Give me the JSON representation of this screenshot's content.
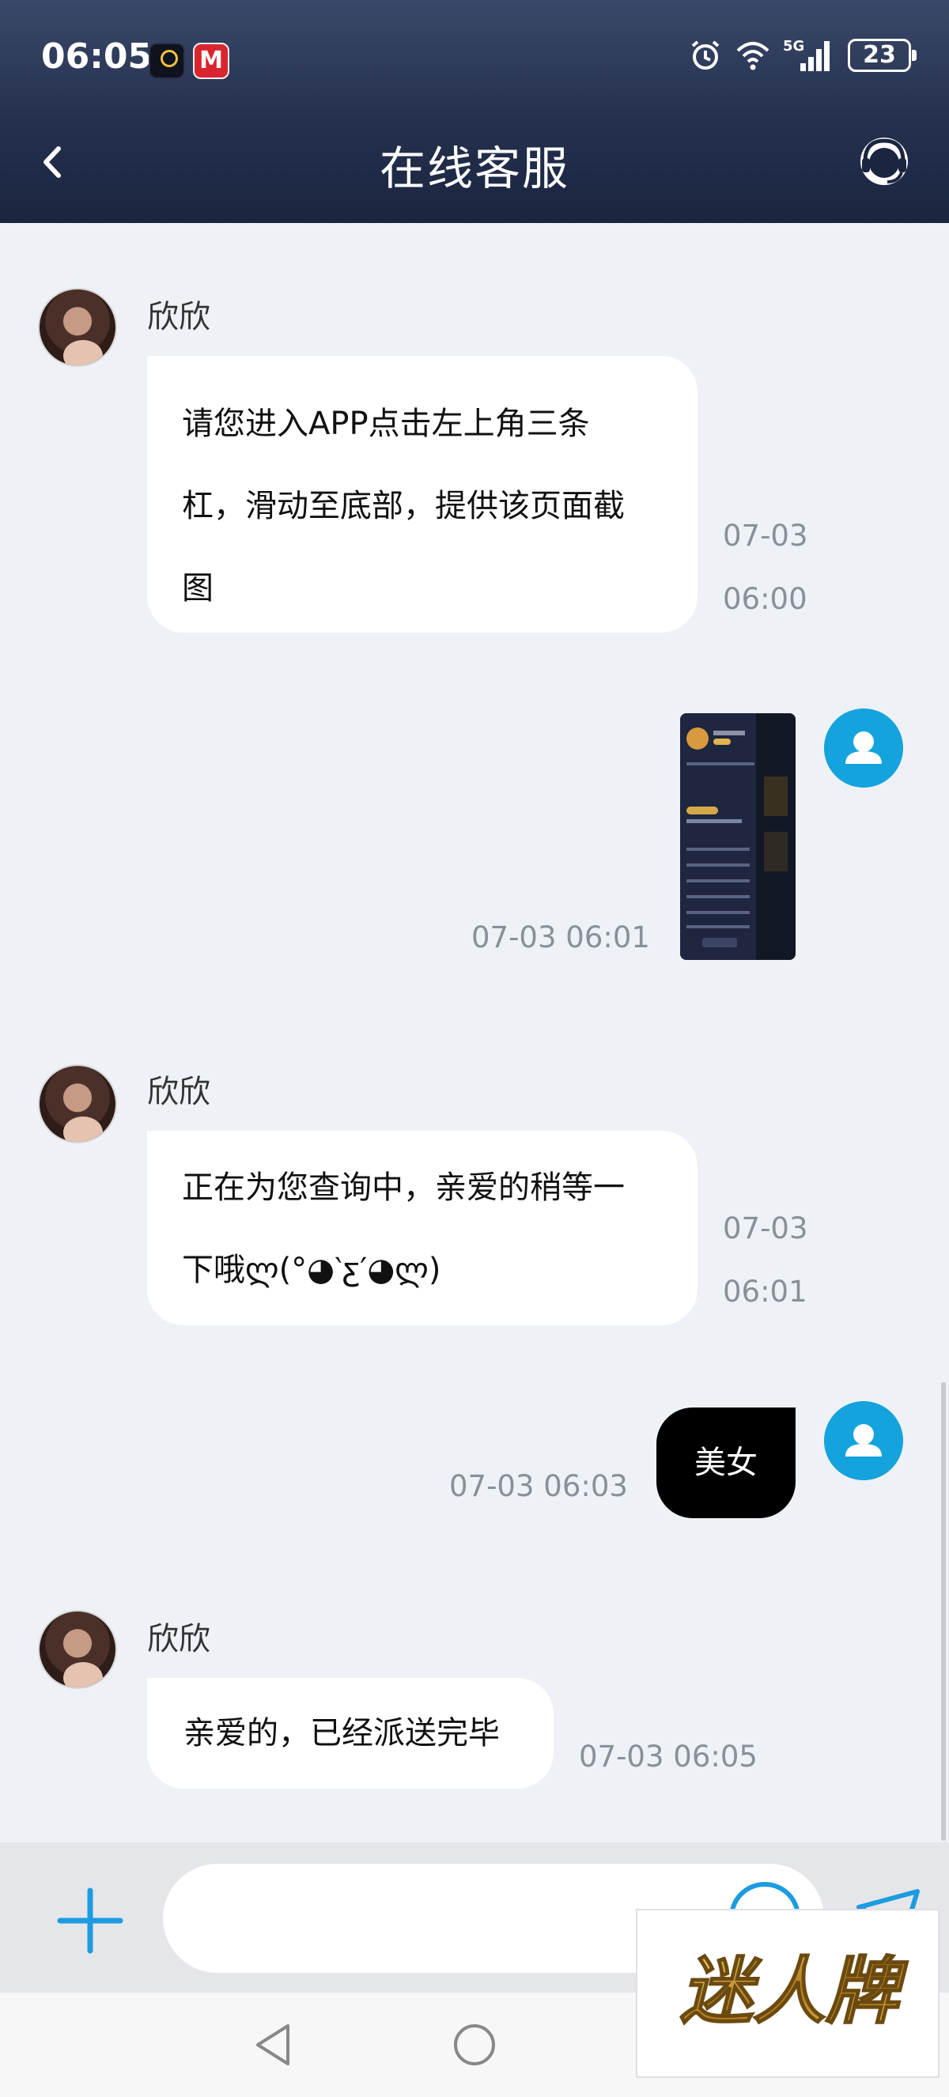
{
  "status_bar": {
    "time": "06:05",
    "network": "5G",
    "battery": "23",
    "app2_glyph": "M"
  },
  "header": {
    "title": "在线客服"
  },
  "icons": {
    "back": "chevron-left-icon",
    "support": "headset-icon",
    "plus": "plus-icon",
    "emoji": "emoji-icon",
    "send": "send-icon",
    "alarm": "alarm-icon",
    "wifi": "wifi-icon",
    "signal": "signal-icon"
  },
  "messages": [
    {
      "from": "agent",
      "sender": "欣欣",
      "lines": [
        "请您进入APP点击左上角三条",
        "杠，滑动至底部，提供该页面截",
        "图"
      ],
      "time_date": "07-03",
      "time_clock": "06:00"
    },
    {
      "from": "user",
      "type": "image",
      "time": "07-03 06:01"
    },
    {
      "from": "agent",
      "sender": "欣欣",
      "lines": [
        "正在为您查询中，亲爱的稍等一",
        "下哦ლ(°◕‵ƹ′◕ლ)"
      ],
      "time_date": "07-03",
      "time_clock": "06:01"
    },
    {
      "from": "user",
      "text": "美女",
      "time": "07-03 06:03"
    },
    {
      "from": "agent",
      "sender": "欣欣",
      "lines": [
        "亲爱的，已经派送完毕"
      ],
      "time": "07-03 06:05"
    }
  ],
  "input": {
    "placeholder": "",
    "value": ""
  },
  "watermark": {
    "text": "迷人牌"
  },
  "colors": {
    "header_top": "#3b4869",
    "header_bottom": "#1b2540",
    "accent": "#1d9be0",
    "user_avatar": "#15a3dd",
    "background": "#eef2f6"
  }
}
